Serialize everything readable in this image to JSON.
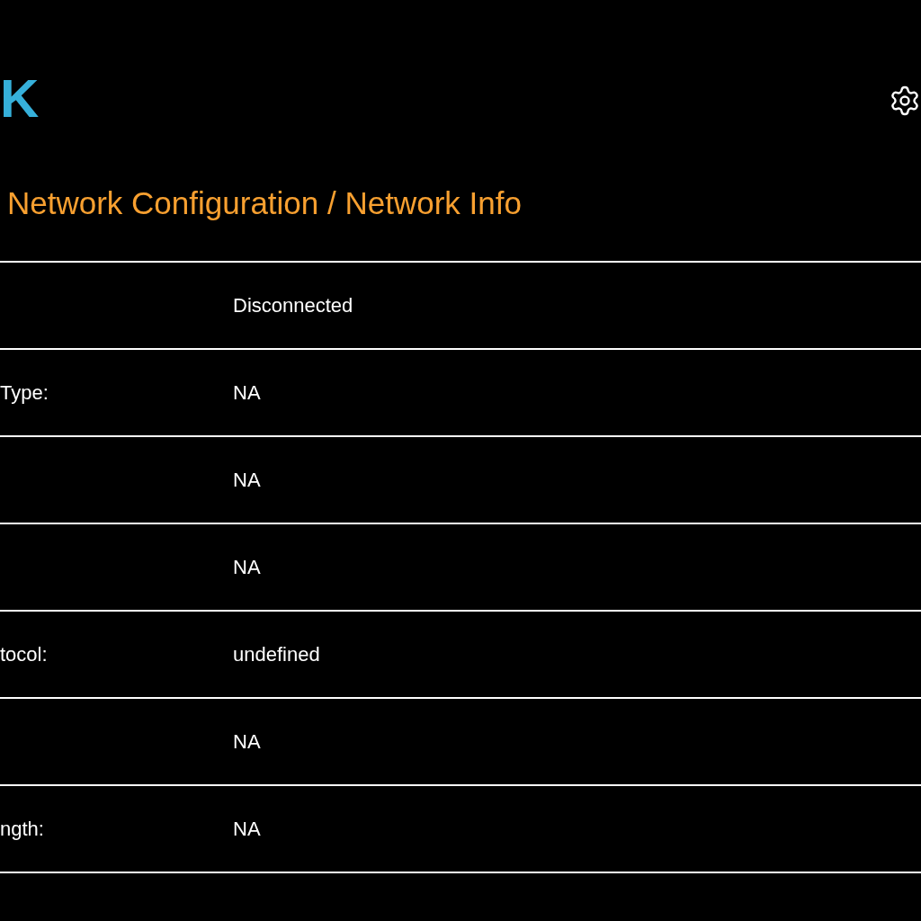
{
  "header": {
    "logo": "K"
  },
  "title": "Network Configuration / Network Info",
  "rows": [
    {
      "value": "Disconnected"
    },
    {
      "label": "Type:",
      "value": "NA"
    },
    {
      "value": "NA"
    },
    {
      "value": "NA"
    },
    {
      "label": "tocol:",
      "value": "undefined"
    },
    {
      "value": "NA"
    },
    {
      "label": "ngth:",
      "value": "NA"
    }
  ]
}
